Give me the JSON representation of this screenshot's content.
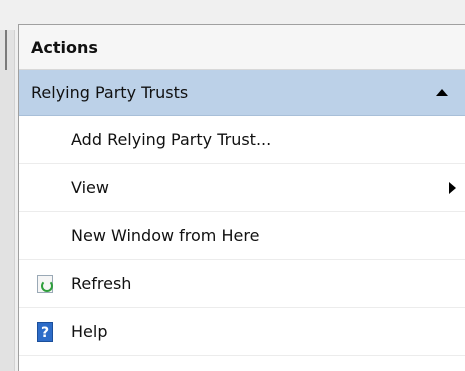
{
  "actions_pane": {
    "title": "Actions",
    "section": {
      "label": "Relying Party Trusts"
    },
    "items": [
      {
        "label": "Add Relying Party Trust...",
        "icon": ""
      },
      {
        "label": "View",
        "icon": "",
        "has_submenu": true
      },
      {
        "label": "New Window from Here",
        "icon": ""
      },
      {
        "label": "Refresh",
        "icon": "refresh-icon"
      },
      {
        "label": "Help",
        "icon": "help-icon",
        "icon_glyph": "?"
      }
    ]
  },
  "colors": {
    "section_bg": "#bcd1e8",
    "header_bg": "#f6f6f6",
    "refresh_accent": "#2e9e3b",
    "help_blue": "#2d6cc8"
  }
}
